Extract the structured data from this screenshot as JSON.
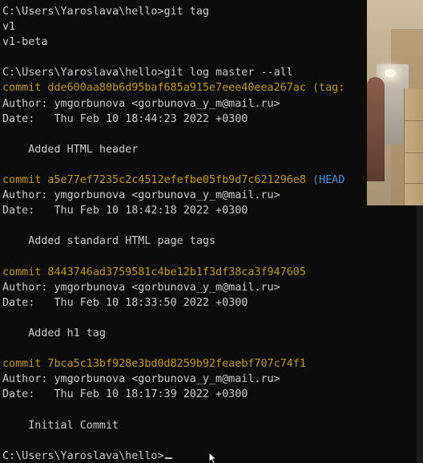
{
  "terminal": {
    "lines": [
      {
        "kind": "plain",
        "text": "C:\\Users\\Yaroslava\\hello>git tag"
      },
      {
        "kind": "plain",
        "text": "v1"
      },
      {
        "kind": "plain",
        "text": "v1-beta"
      },
      {
        "kind": "plain",
        "text": ""
      },
      {
        "kind": "plain",
        "text": "C:\\Users\\Yaroslava\\hello>git log master --all"
      },
      {
        "kind": "commit",
        "text": "commit dde600aa80b6d95baf685a915e7eee40eea267ac",
        "ref": " (tag:",
        "ref_style": "tag"
      },
      {
        "kind": "plain",
        "text": "Author: ymgorbunova <gorbunova_y_m@mail.ru>"
      },
      {
        "kind": "plain",
        "text": "Date:   Thu Feb 10 18:44:23 2022 +0300"
      },
      {
        "kind": "plain",
        "text": ""
      },
      {
        "kind": "plain",
        "text": "    Added HTML header"
      },
      {
        "kind": "plain",
        "text": ""
      },
      {
        "kind": "commit",
        "text": "commit a5e77ef7235c2c4512efefbe05fb9d7c621296e8",
        "ref": " (HEAD",
        "ref_style": "head"
      },
      {
        "kind": "plain",
        "text": "Author: ymgorbunova <gorbunova_y_m@mail.ru>"
      },
      {
        "kind": "plain",
        "text": "Date:   Thu Feb 10 18:42:18 2022 +0300"
      },
      {
        "kind": "plain",
        "text": ""
      },
      {
        "kind": "plain",
        "text": "    Added standard HTML page tags"
      },
      {
        "kind": "plain",
        "text": ""
      },
      {
        "kind": "commit",
        "text": "commit 8443746ad3759581c4be12b1f3df38ca3f947605",
        "ref": "",
        "ref_style": ""
      },
      {
        "kind": "plain",
        "text": "Author: ymgorbunova <gorbunova_y_m@mail.ru>"
      },
      {
        "kind": "plain",
        "text": "Date:   Thu Feb 10 18:33:50 2022 +0300"
      },
      {
        "kind": "plain",
        "text": ""
      },
      {
        "kind": "plain",
        "text": "    Added h1 tag"
      },
      {
        "kind": "plain",
        "text": ""
      },
      {
        "kind": "commit",
        "text": "commit 7bca5c13bf928e3bd0d8259b92feaebf707c74f1",
        "ref": "",
        "ref_style": ""
      },
      {
        "kind": "plain",
        "text": "Author: ymgorbunova <gorbunova_y_m@mail.ru>"
      },
      {
        "kind": "plain",
        "text": "Date:   Thu Feb 10 18:17:39 2022 +0300"
      },
      {
        "kind": "plain",
        "text": ""
      },
      {
        "kind": "plain",
        "text": "    Initial Commit"
      },
      {
        "kind": "plain",
        "text": ""
      },
      {
        "kind": "prompt",
        "text": "C:\\Users\\Yaroslava\\hello>"
      }
    ]
  },
  "colors": {
    "background": "#0c0c0c",
    "foreground": "#cccccc",
    "commit": "#c19c00",
    "head_ref": "#3a96dd"
  },
  "icons": {
    "pointer": "mouse-pointer-icon"
  }
}
